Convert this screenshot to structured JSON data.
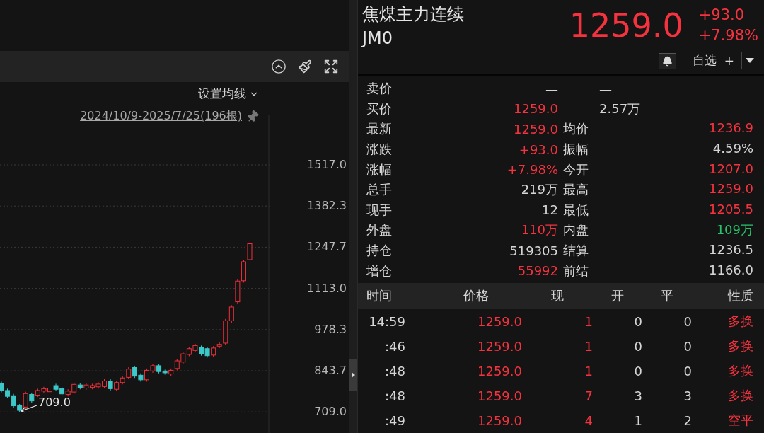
{
  "chart_panel": {
    "ma_setting": "设置均线",
    "date_range": "2024/10/9-2025/7/25(196根)",
    "low_marker": "709.0",
    "chart_data": {
      "type": "candlestick",
      "ylim": [
        709,
        1517
      ],
      "yticks": [
        {
          "value": 1517,
          "label": "1517.0"
        },
        {
          "value": 1382.3,
          "label": "1382.3"
        },
        {
          "value": 1247.7,
          "label": "1247.7"
        },
        {
          "value": 1113,
          "label": "1113.0"
        },
        {
          "value": 978.3,
          "label": "978.3"
        },
        {
          "value": 843.7,
          "label": "843.7"
        },
        {
          "value": 709,
          "label": "709.0"
        }
      ],
      "grid": true,
      "ohlc": [
        [
          802,
          808,
          773,
          779
        ],
        [
          779,
          785,
          754,
          760
        ],
        [
          762,
          768,
          723,
          729
        ],
        [
          729,
          735,
          709,
          714
        ],
        [
          725,
          775,
          719,
          769
        ],
        [
          766,
          772,
          739,
          745
        ],
        [
          764,
          785,
          758,
          779
        ],
        [
          777,
          791,
          771,
          785
        ],
        [
          775,
          793,
          769,
          787
        ],
        [
          795,
          801,
          777,
          783
        ],
        [
          785,
          791,
          762,
          768
        ],
        [
          766,
          783,
          760,
          777
        ],
        [
          774,
          805,
          768,
          799
        ],
        [
          797,
          803,
          783,
          789
        ],
        [
          787,
          803,
          781,
          797
        ],
        [
          789,
          801,
          783,
          795
        ],
        [
          791,
          806,
          785,
          800
        ],
        [
          792,
          816,
          786,
          810
        ],
        [
          810,
          816,
          779,
          785
        ],
        [
          783,
          811,
          777,
          805
        ],
        [
          805,
          826,
          799,
          820
        ],
        [
          822,
          855,
          816,
          849
        ],
        [
          854,
          860,
          820,
          826
        ],
        [
          829,
          835,
          808,
          814
        ],
        [
          814,
          851,
          808,
          845
        ],
        [
          843,
          866,
          837,
          860
        ],
        [
          860,
          866,
          835,
          841
        ],
        [
          841,
          847,
          831,
          837
        ],
        [
          833,
          851,
          827,
          845
        ],
        [
          851,
          882,
          845,
          876
        ],
        [
          872,
          905,
          866,
          899
        ],
        [
          897,
          922,
          891,
          916
        ],
        [
          910,
          932,
          904,
          926
        ],
        [
          920,
          926,
          893,
          899
        ],
        [
          916,
          922,
          887,
          893
        ],
        [
          895,
          924,
          889,
          918
        ],
        [
          924,
          936,
          918,
          930
        ],
        [
          934,
          1013,
          928,
          1007
        ],
        [
          1007,
          1058,
          1001,
          1052
        ],
        [
          1069,
          1143,
          1063,
          1137
        ],
        [
          1138,
          1206,
          1132,
          1200
        ],
        [
          1207,
          1259,
          1205.5,
          1259
        ]
      ]
    }
  },
  "quote": {
    "name": "焦煤主力连续",
    "code": "JM0",
    "price": "1259.0",
    "change": "+93.0",
    "change_pct": "+7.98%",
    "color": "#f5333f",
    "watchlist_button": "自选",
    "add_symbol": "+"
  },
  "stats": [
    {
      "kind": "bidask",
      "label": "卖价",
      "price": {
        "text": "—",
        "color": "#d6d6d6"
      },
      "volume": "—"
    },
    {
      "kind": "bidask",
      "label": "买价",
      "price": {
        "text": "1259.0",
        "color": "#f5333f"
      },
      "volume": "2.57万"
    },
    {
      "kind": "pair",
      "label": "最新",
      "value": {
        "text": "1259.0",
        "color": "#f5333f"
      },
      "label2": "均价",
      "value2": {
        "text": "1236.9",
        "color": "#f5333f"
      }
    },
    {
      "kind": "pair",
      "label": "涨跌",
      "value": {
        "text": "+93.0",
        "color": "#f5333f"
      },
      "label2": "振幅",
      "value2": {
        "text": "4.59%",
        "color": "#d6d6d6"
      }
    },
    {
      "kind": "pair",
      "label": "涨幅",
      "value": {
        "text": "+7.98%",
        "color": "#f5333f"
      },
      "label2": "今开",
      "value2": {
        "text": "1207.0",
        "color": "#f5333f"
      }
    },
    {
      "kind": "pair",
      "label": "总手",
      "value": {
        "text": "219万",
        "color": "#d6d6d6"
      },
      "label2": "最高",
      "value2": {
        "text": "1259.0",
        "color": "#f5333f"
      }
    },
    {
      "kind": "pair",
      "label": "现手",
      "value": {
        "text": "12",
        "color": "#d6d6d6"
      },
      "label2": "最低",
      "value2": {
        "text": "1205.5",
        "color": "#f5333f"
      }
    },
    {
      "kind": "pair",
      "label": "外盘",
      "value": {
        "text": "110万",
        "color": "#f5333f"
      },
      "label2": "内盘",
      "value2": {
        "text": "109万",
        "color": "#27c26a"
      }
    },
    {
      "kind": "pair",
      "label": "持仓",
      "value": {
        "text": "519305",
        "color": "#d6d6d6"
      },
      "label2": "结算",
      "value2": {
        "text": "1236.5",
        "color": "#d6d6d6"
      }
    },
    {
      "kind": "pair",
      "label": "增仓",
      "value": {
        "text": "55992",
        "color": "#f5333f"
      },
      "label2": "前结",
      "value2": {
        "text": "1166.0",
        "color": "#d6d6d6"
      }
    }
  ],
  "trades": {
    "columns": [
      "时间",
      "价格",
      "现",
      "开",
      "平",
      "性质"
    ],
    "rows": [
      {
        "time": "14:59",
        "price": "1259.0",
        "volume": "1",
        "open": "0",
        "close": "0",
        "nature": "多换",
        "color": "#f5333f"
      },
      {
        "time": ":46",
        "price": "1259.0",
        "volume": "1",
        "open": "0",
        "close": "0",
        "nature": "多换",
        "color": "#f5333f"
      },
      {
        "time": ":48",
        "price": "1259.0",
        "volume": "1",
        "open": "0",
        "close": "0",
        "nature": "多换",
        "color": "#f5333f"
      },
      {
        "time": ":48",
        "price": "1259.0",
        "volume": "7",
        "open": "3",
        "close": "3",
        "nature": "多换",
        "color": "#f5333f"
      },
      {
        "time": ":49",
        "price": "1259.0",
        "volume": "4",
        "open": "1",
        "close": "2",
        "nature": "空平",
        "color": "#f5333f"
      }
    ]
  }
}
